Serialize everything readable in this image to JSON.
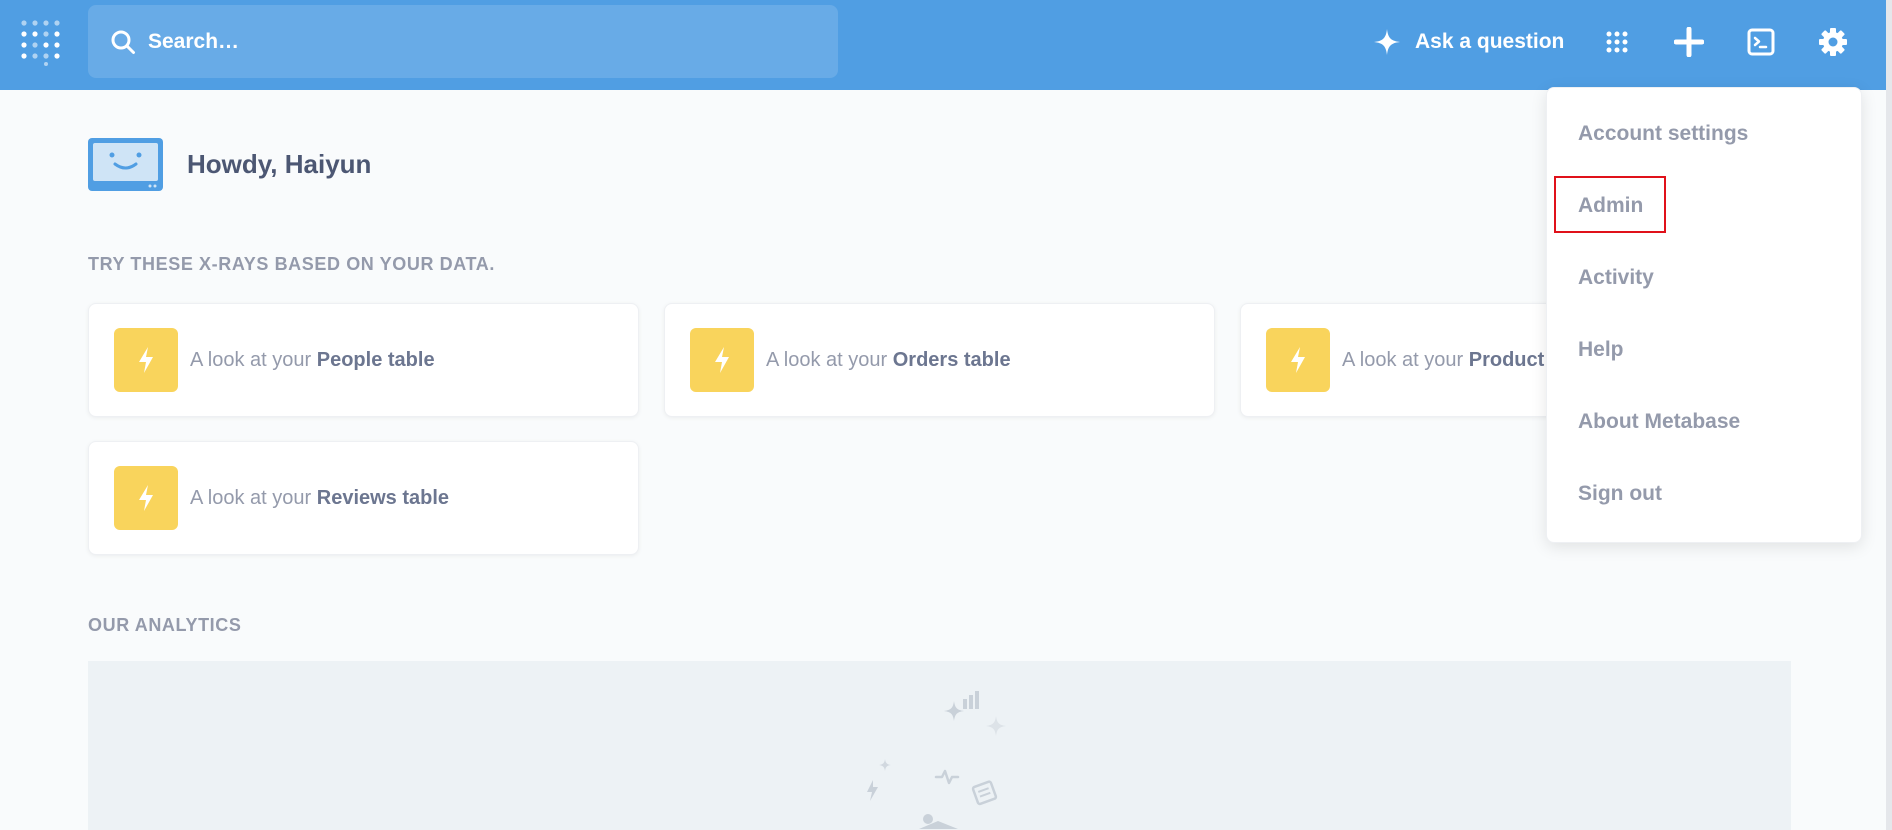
{
  "nav": {
    "search_placeholder": "Search…",
    "ask_label": "Ask a question",
    "icons": [
      "apps-grid-icon",
      "plus-icon",
      "terminal-icon",
      "gear-icon"
    ]
  },
  "greeting": "Howdy, Haiyun",
  "xrays": {
    "title": "TRY THESE X-RAYS BASED ON YOUR DATA.",
    "cards": [
      {
        "prefix": "A look at your ",
        "table": "People table"
      },
      {
        "prefix": "A look at your ",
        "table": "Orders table"
      },
      {
        "prefix": "A look at your ",
        "table": "Product"
      },
      {
        "prefix": "A look at your ",
        "table": "Reviews table"
      }
    ]
  },
  "analytics": {
    "title": "OUR ANALYTICS"
  },
  "settings_menu": {
    "items": [
      {
        "label": "Account settings"
      },
      {
        "label": "Admin"
      },
      {
        "label": "Activity"
      },
      {
        "label": "Help"
      },
      {
        "label": "About Metabase"
      },
      {
        "label": "Sign out"
      }
    ]
  },
  "colors": {
    "brand": "#509ee3",
    "xray_bolt": "#f9d45c",
    "text_dark": "#4c5773",
    "text_light": "#949aab",
    "highlight": "#e0111a"
  }
}
